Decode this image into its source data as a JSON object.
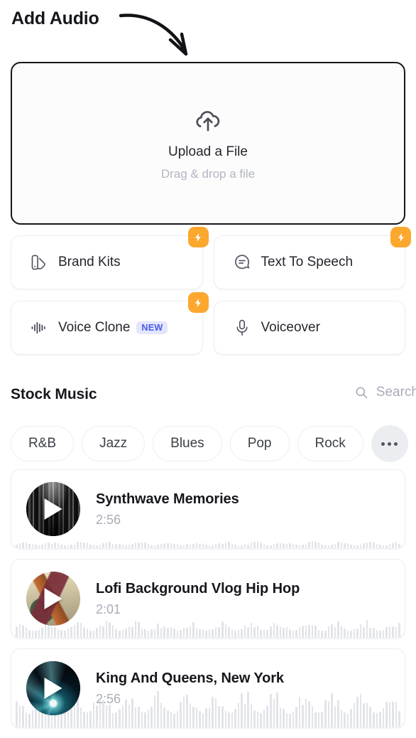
{
  "header": {
    "title": "Add Audio",
    "annotation_icon": "curved-arrow"
  },
  "dropzone": {
    "icon": "cloud-upload-icon",
    "title": "Upload a File",
    "subtitle": "Drag & drop a file"
  },
  "features": [
    {
      "label": "Brand Kits",
      "icon": "brand-kits-icon",
      "pro": true,
      "new": false,
      "badge_icon": "lightning-bolt-icon"
    },
    {
      "label": "Text To Speech",
      "icon": "text-to-speech-icon",
      "pro": true,
      "new": false,
      "badge_icon": "lightning-bolt-icon"
    },
    {
      "label": "Voice Clone",
      "icon": "voice-clone-icon",
      "pro": true,
      "new": true,
      "badge_icon": "lightning-bolt-icon",
      "new_label": "NEW"
    },
    {
      "label": "Voiceover",
      "icon": "microphone-icon",
      "pro": false,
      "new": false
    }
  ],
  "stock_music": {
    "title": "Stock Music",
    "search_label": "Search",
    "search_icon": "search-icon",
    "more_icon": "ellipsis-icon",
    "genres": [
      "R&B",
      "Jazz",
      "Blues",
      "Pop",
      "Rock"
    ],
    "tracks": [
      {
        "title": "Synthwave Memories",
        "duration": "2:56",
        "art": "art-synthwave",
        "play_icon": "play-icon"
      },
      {
        "title": "Lofi Background Vlog Hip Hop",
        "duration": "2:01",
        "art": "art-lofi",
        "play_icon": "play-icon"
      },
      {
        "title": "King And Queens, New York",
        "duration": "2:56",
        "art": "art-kings",
        "play_icon": "play-icon"
      }
    ]
  },
  "colors": {
    "accent_orange": "#fca72e",
    "new_badge_bg": "#e3e6fd",
    "new_badge_text": "#4a5ae8",
    "muted_text": "#a9adb8",
    "border": "#eceef1",
    "waveform": "#dde0e6"
  }
}
